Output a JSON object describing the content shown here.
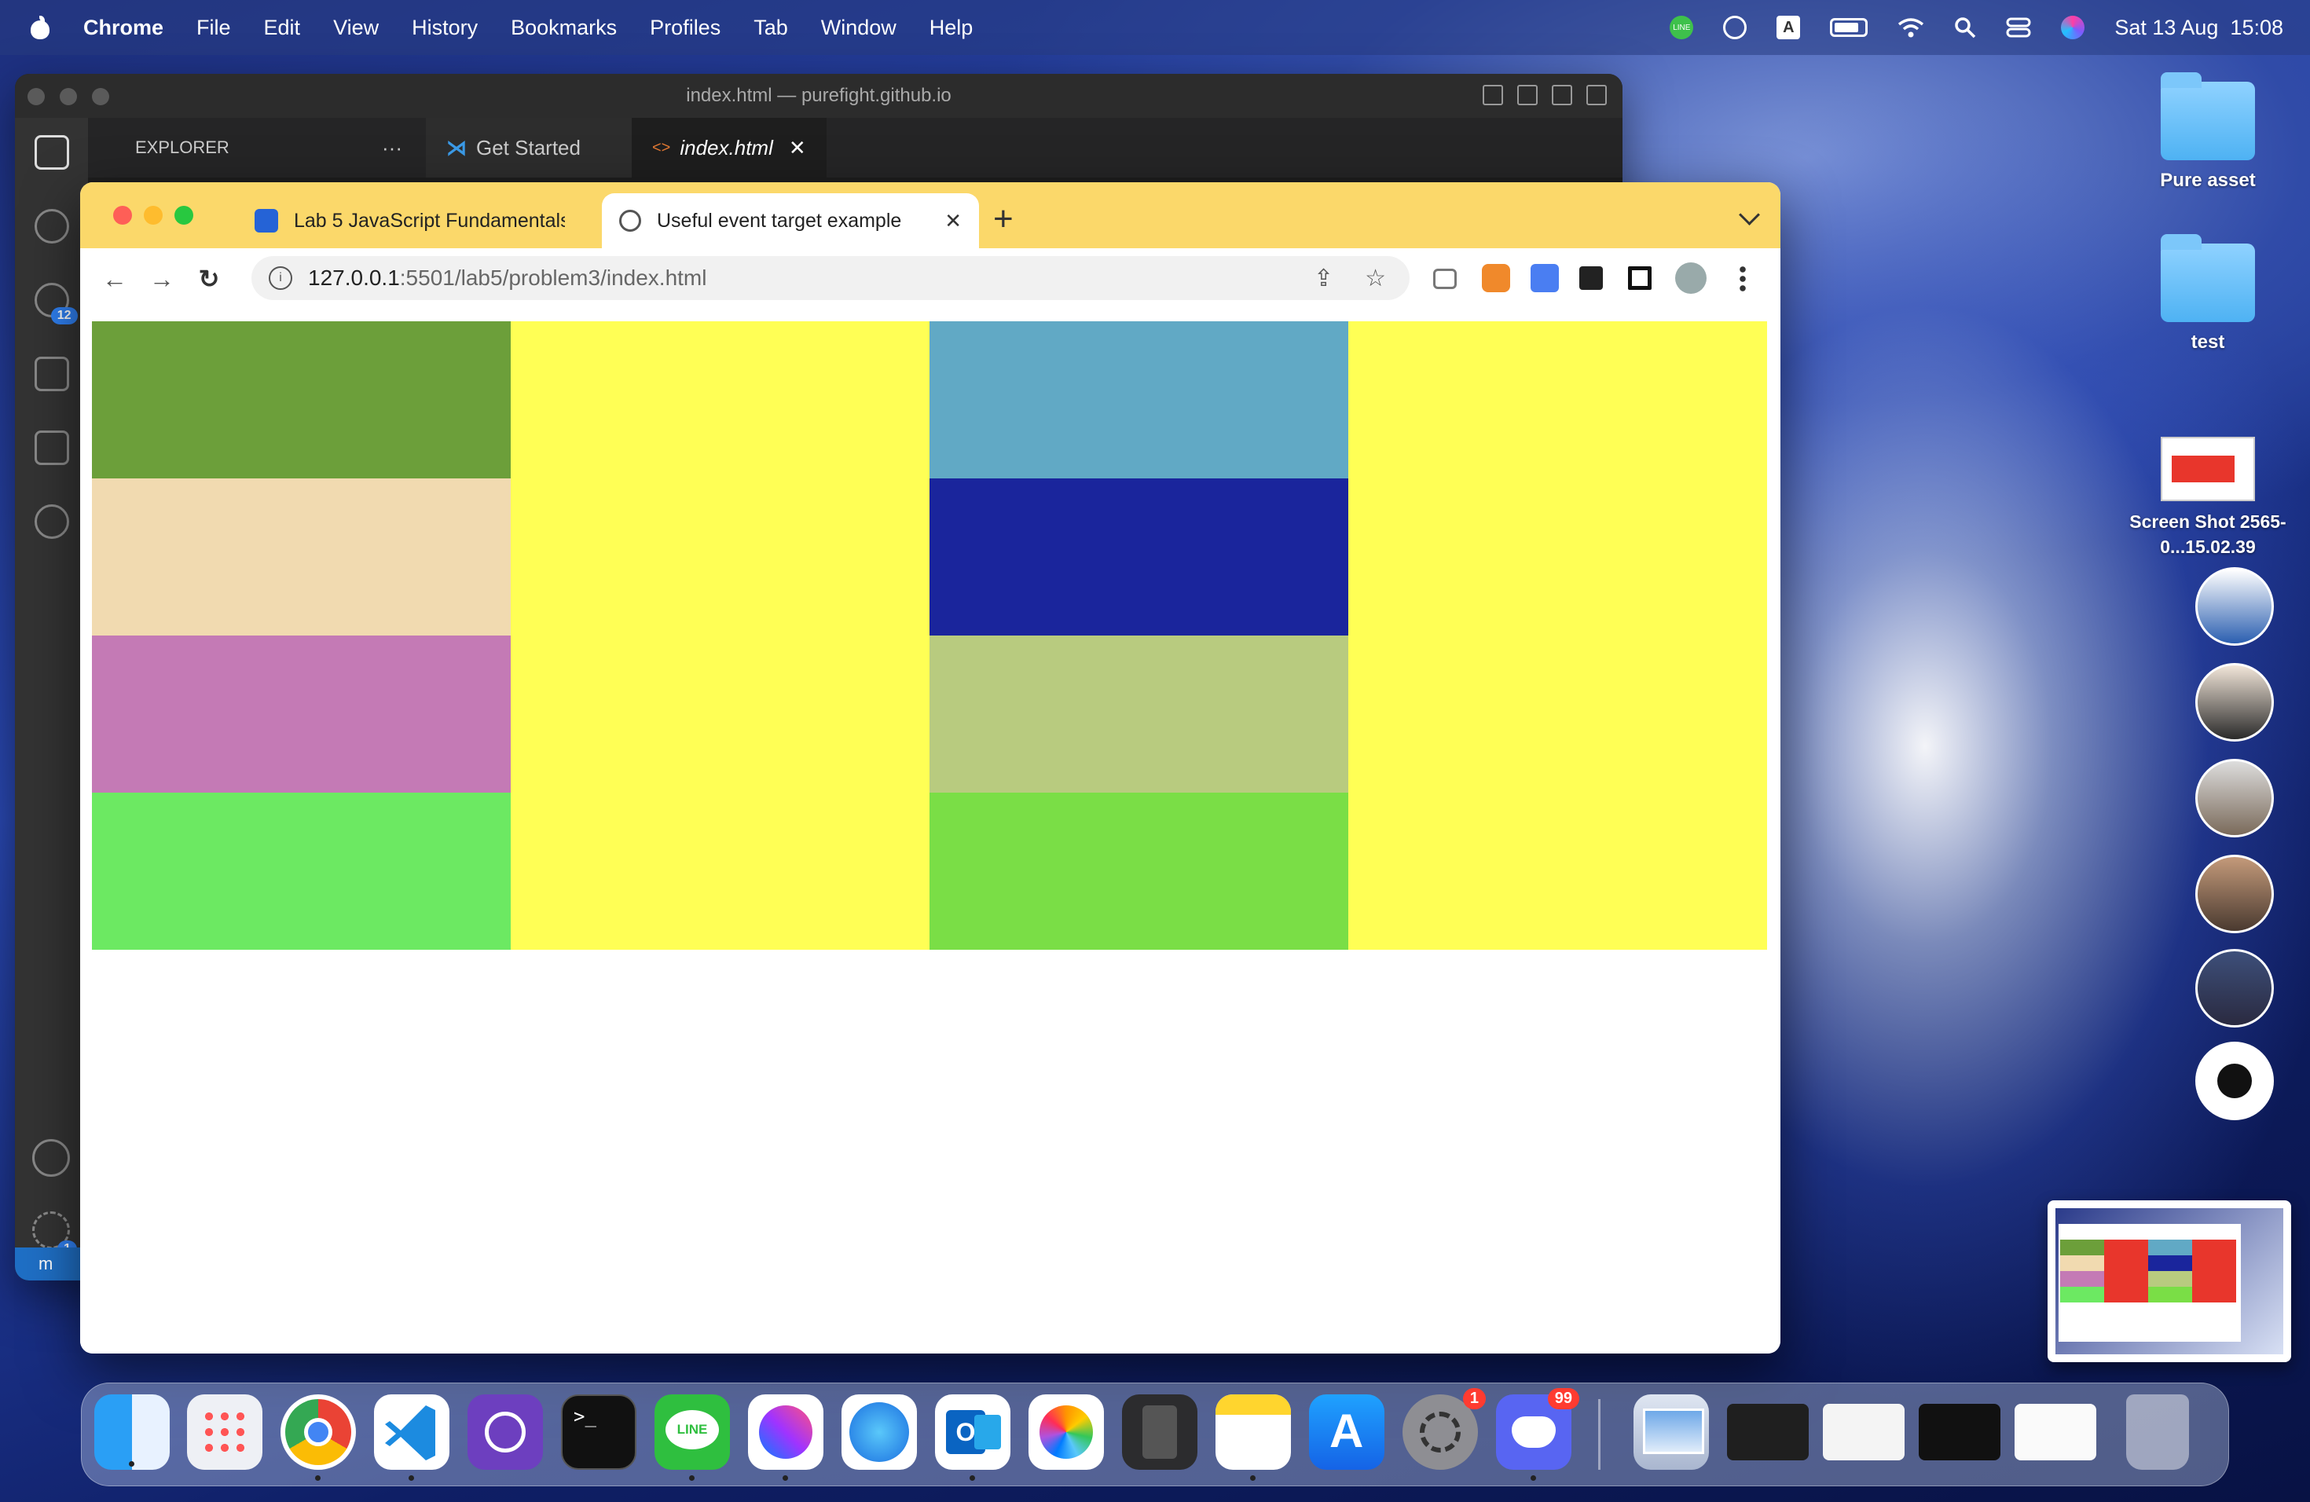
{
  "menubar": {
    "items": [
      "Chrome",
      "File",
      "Edit",
      "View",
      "History",
      "Bookmarks",
      "Profiles",
      "Tab",
      "Window",
      "Help"
    ],
    "status_icons": [
      "line-icon",
      "play-icon",
      "input-source-icon",
      "battery-icon",
      "wifi-icon",
      "search-icon",
      "control-center-icon",
      "siri-icon"
    ],
    "input_source": "A",
    "line_label": "LINE",
    "clock": "Sat 13 Aug  15:08"
  },
  "vscode": {
    "title": "index.html — purefight.github.io",
    "explorer_label": "EXPLORER",
    "explorer_more": "···",
    "tabs": [
      {
        "label": "Get Started",
        "icon": "vscode-icon"
      },
      {
        "label": "index.html",
        "icon": "html-icon",
        "close": "✕"
      }
    ],
    "source_control_badge": "12",
    "settings_badge": "1",
    "status_branch": "m"
  },
  "chrome": {
    "tabs": [
      {
        "title": "Lab 5 JavaScript Fundamentals",
        "close": "✕"
      },
      {
        "title": "Useful event target example",
        "close": "✕"
      }
    ],
    "new_tab": "+",
    "url_host": "127.0.0.1",
    "url_path": ":5501/lab5/problem3/index.html",
    "info_glyph": "i"
  },
  "page": {
    "columns": [
      {
        "cells": [
          "#6c9f3a",
          "#f1dab0",
          "#c47ab5",
          "#6ce962"
        ]
      },
      {
        "cells": [
          "#ffff55",
          "#ffff55",
          "#ffff55",
          "#ffff55"
        ]
      },
      {
        "cells": [
          "#61a9c5",
          "#1a259c",
          "#b8cb7f",
          "#7ade46"
        ]
      },
      {
        "cells": [
          "#ffff55",
          "#ffff55",
          "#ffff55",
          "#ffff55"
        ]
      }
    ]
  },
  "desktop": {
    "items": [
      {
        "label": "Pure asset",
        "type": "folder"
      },
      {
        "label": "test",
        "type": "folder"
      },
      {
        "label": "Screen Shot 2565-0...15.02.39",
        "type": "image"
      }
    ],
    "messenger_heads": 6
  },
  "dock": {
    "apps": [
      "Finder",
      "Launchpad",
      "Google Chrome",
      "Visual Studio Code",
      "GitHub Desktop",
      "Terminal",
      "LINE",
      "Messenger",
      "Safari",
      "Outlook",
      "Photos",
      "Calculator",
      "Notes",
      "App Store",
      "System Preferences",
      "Discord",
      "Preview"
    ],
    "system_preferences_badge": "1",
    "discord_badge": "99",
    "terminal_glyph": ">_",
    "line_label": "LINE"
  }
}
